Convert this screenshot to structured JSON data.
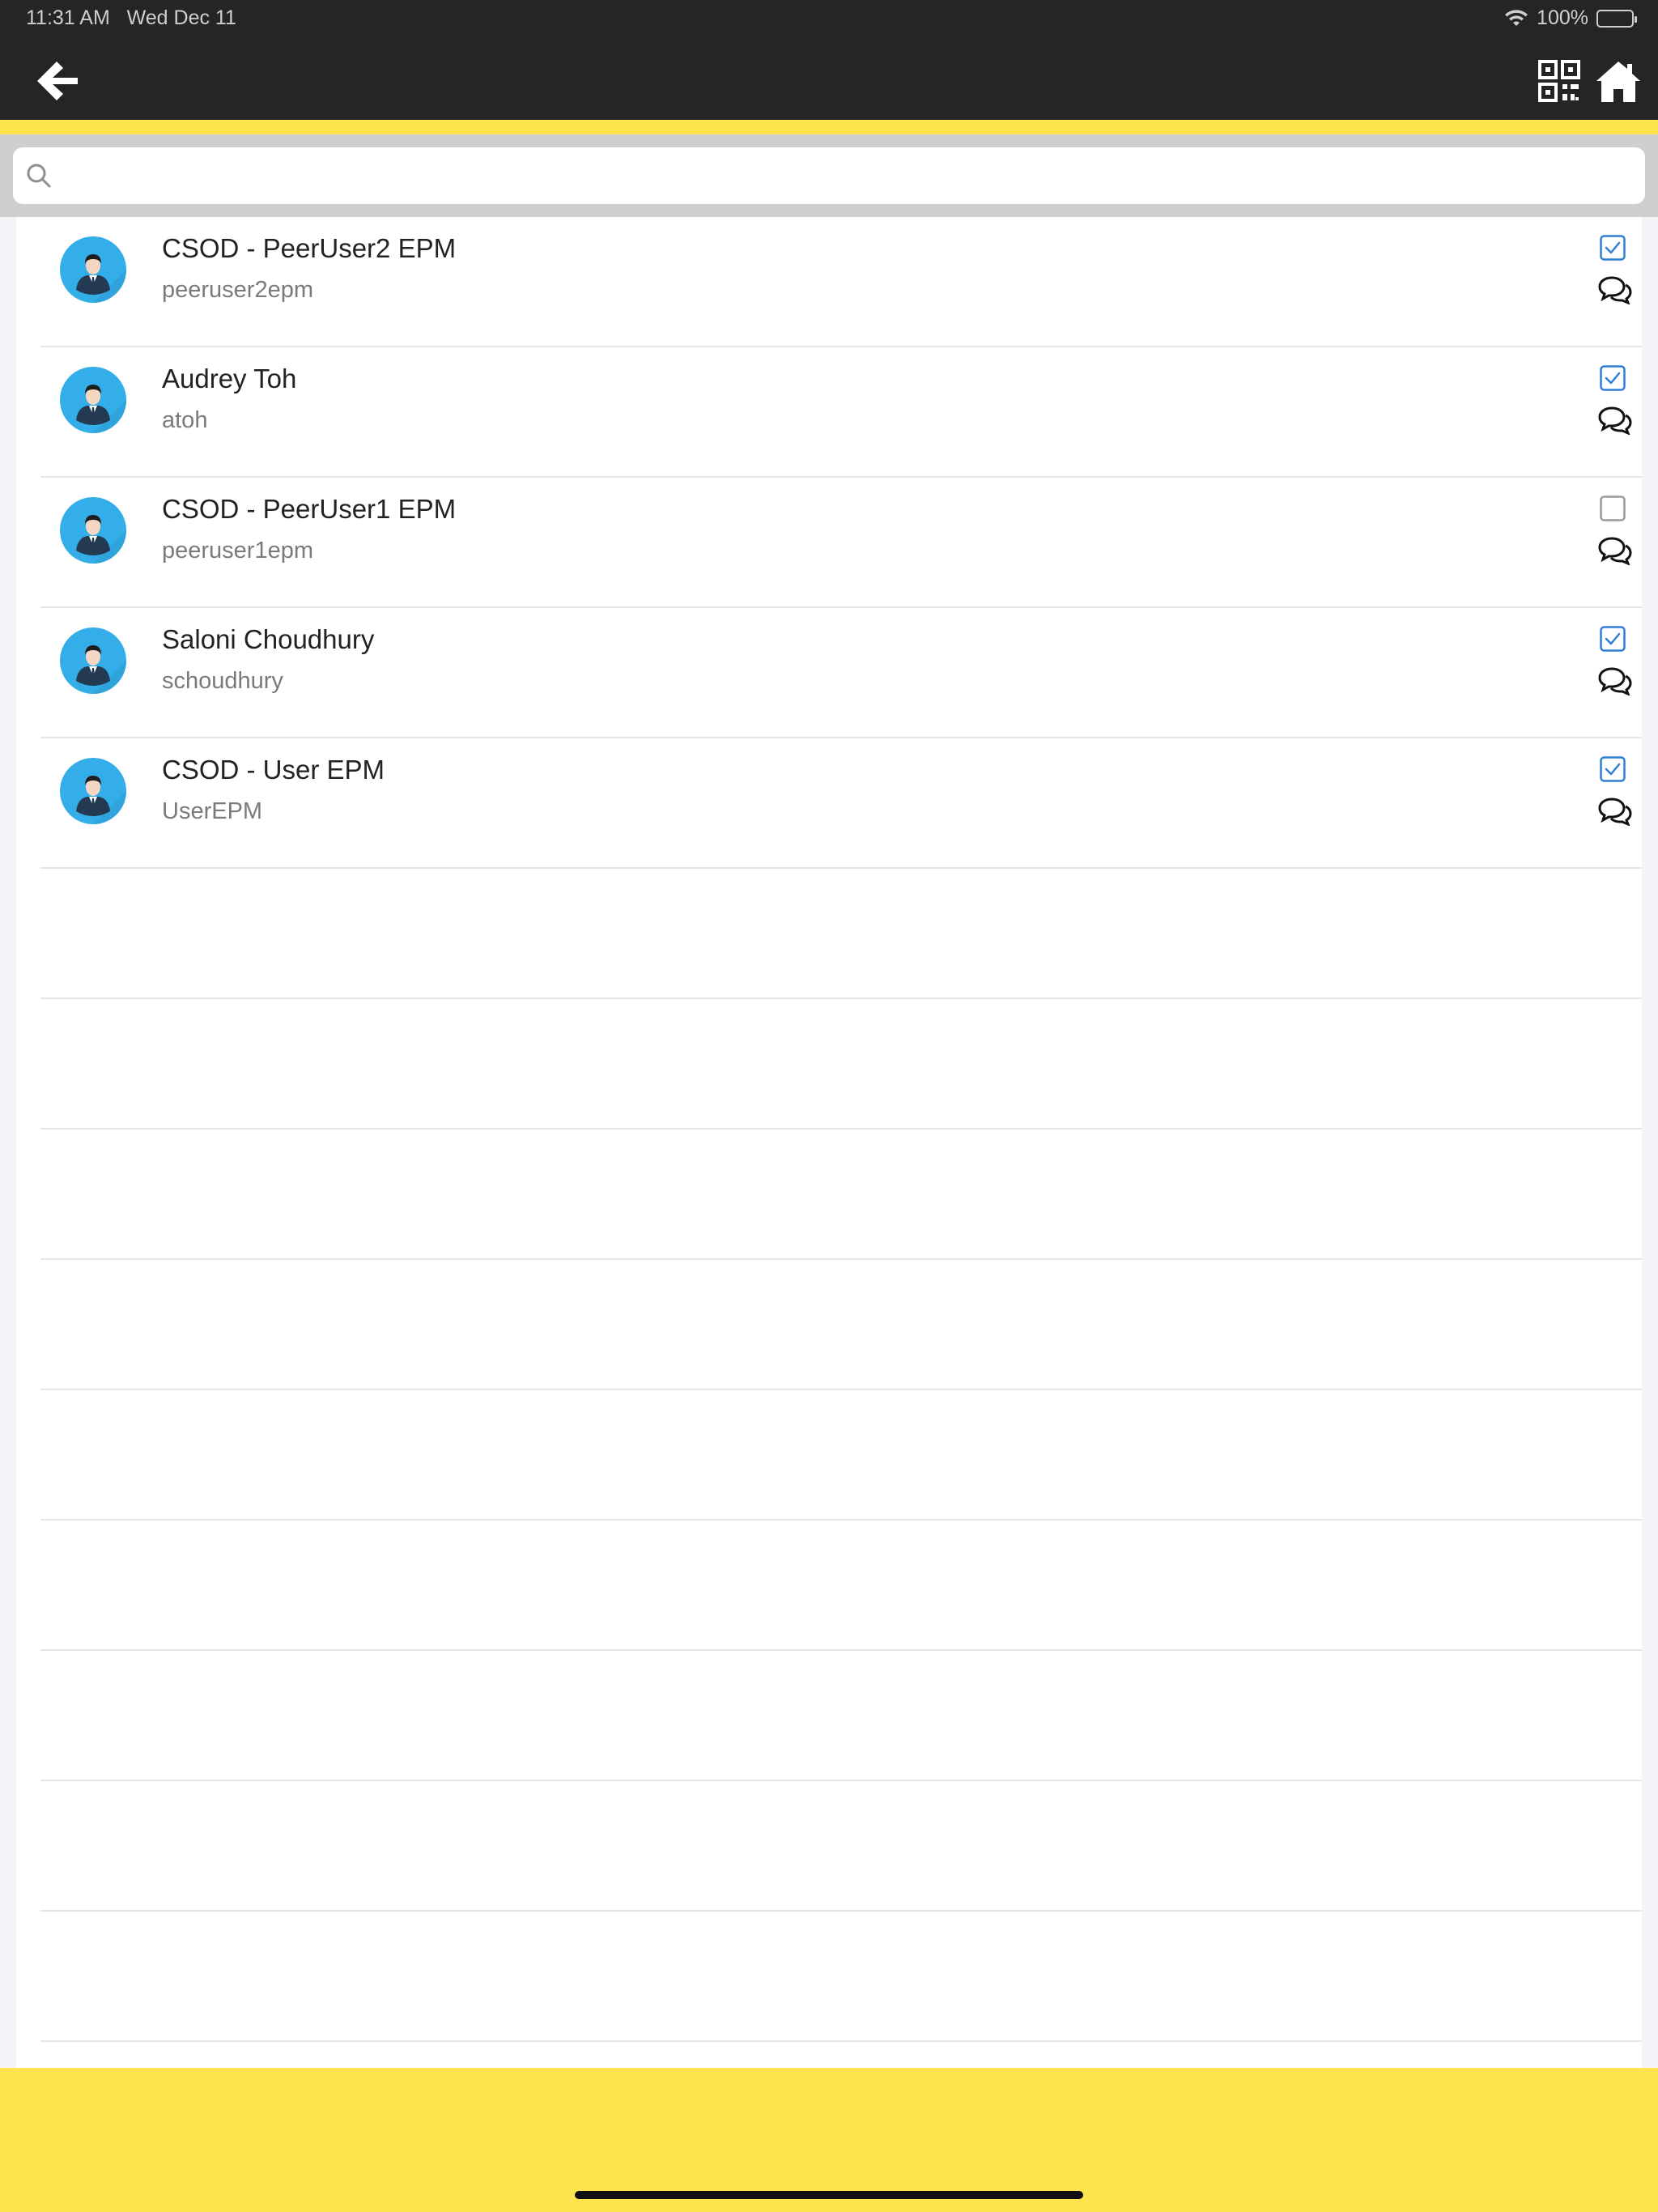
{
  "status_bar": {
    "time": "11:31 AM",
    "date": "Wed Dec 11",
    "battery": "100%"
  },
  "header": {
    "back_icon": "arrow-left-icon",
    "qr_icon": "qr-code-icon",
    "home_icon": "home-icon"
  },
  "search": {
    "placeholder": "",
    "value": ""
  },
  "users": [
    {
      "name": "CSOD - PeerUser2 EPM",
      "username": "peeruser2epm",
      "checked": true
    },
    {
      "name": "Audrey Toh",
      "username": "atoh",
      "checked": true
    },
    {
      "name": "CSOD - PeerUser1 EPM",
      "username": "peeruser1epm",
      "checked": false
    },
    {
      "name": "Saloni Choudhury",
      "username": "schoudhury",
      "checked": true
    },
    {
      "name": "CSOD - User EPM",
      "username": "UserEPM",
      "checked": true
    }
  ],
  "colors": {
    "header_bg": "#252525",
    "accent_yellow": "#ffe44f",
    "checkbox_blue": "#2f7fd6",
    "avatar_blue": "#33aee9"
  }
}
